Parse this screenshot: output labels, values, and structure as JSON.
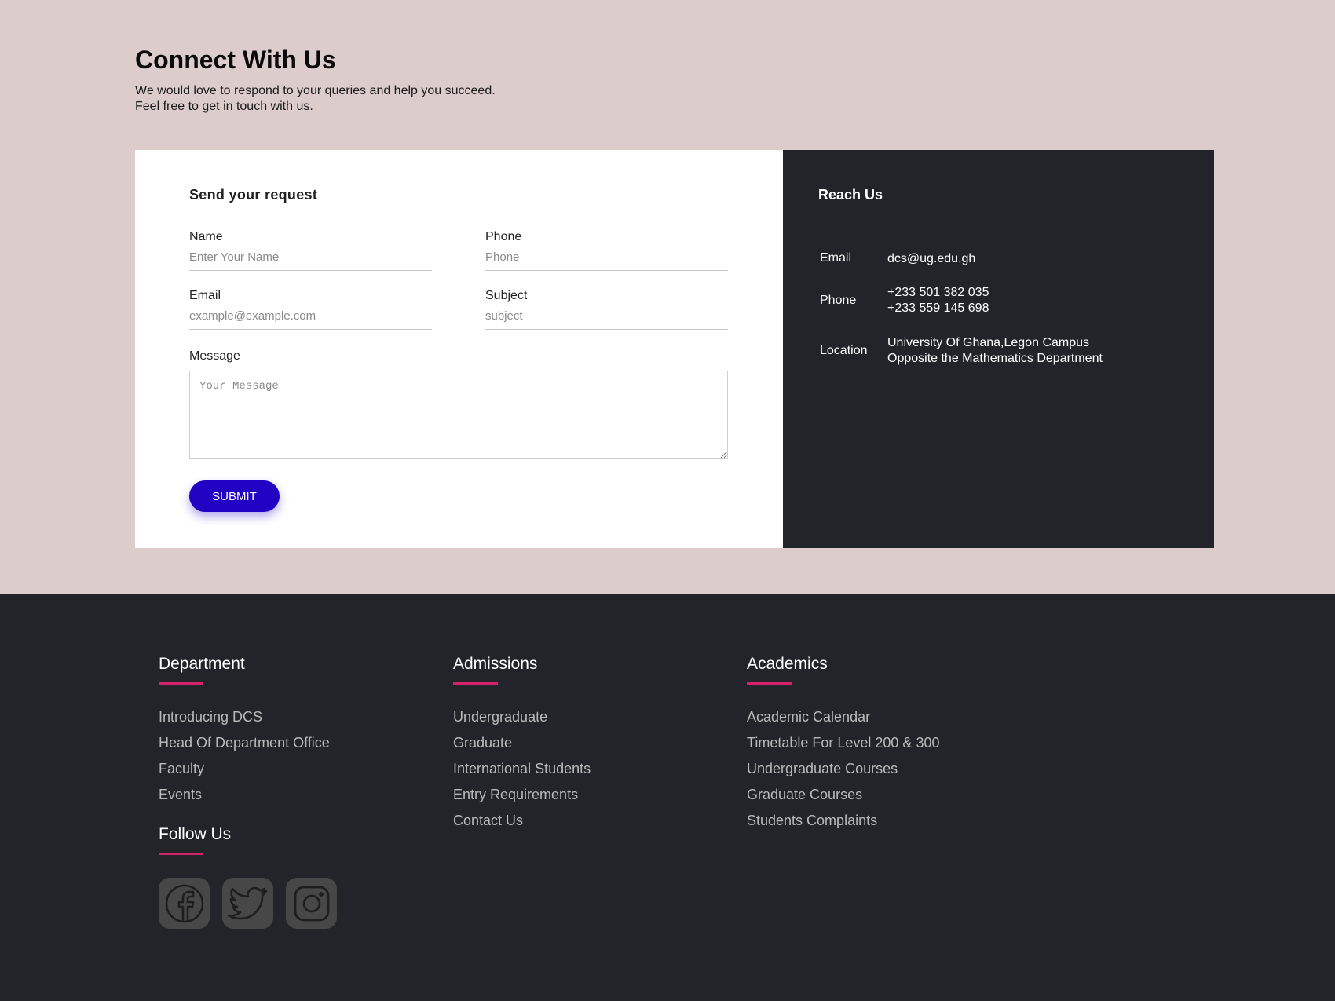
{
  "header": {
    "title": "Connect With Us",
    "subtitle_line1": "We would love to respond to your queries and help you succeed.",
    "subtitle_line2": "Feel free to get in touch with us."
  },
  "form": {
    "heading": "Send your request",
    "name": {
      "label": "Name",
      "placeholder": "Enter Your Name",
      "value": ""
    },
    "phone": {
      "label": "Phone",
      "placeholder": "Phone",
      "value": ""
    },
    "email": {
      "label": "Email",
      "placeholder": "example@example.com",
      "value": ""
    },
    "subject": {
      "label": "Subject",
      "placeholder": "subject",
      "value": ""
    },
    "message": {
      "label": "Message",
      "placeholder": "Your Message",
      "value": ""
    },
    "submit_label": "SUBMIT"
  },
  "reach": {
    "heading": "Reach Us",
    "email_label": "Email",
    "email_value": "dcs@ug.edu.gh",
    "phone_label": "Phone",
    "phone_line1": "+233 501 382 035",
    "phone_line2": "+233 559 145 698",
    "location_label": "Location",
    "location_line1": "University Of Ghana,Legon Campus",
    "location_line2": "Opposite the Mathematics Department"
  },
  "footer": {
    "department": {
      "title": "Department",
      "items": [
        "Introducing DCS",
        "Head Of Department Office",
        "Faculty",
        "Events"
      ]
    },
    "admissions": {
      "title": "Admissions",
      "items": [
        "Undergraduate",
        "Graduate",
        "International Students",
        "Entry Requirements",
        "Contact Us"
      ]
    },
    "academics": {
      "title": "Academics",
      "items": [
        "Academic Calendar",
        "Timetable For Level 200 & 300",
        "Undergraduate Courses",
        "Graduate Courses",
        "Students Complaints"
      ]
    },
    "follow": {
      "title": "Follow Us",
      "icons": [
        "facebook-icon",
        "twitter-icon",
        "instagram-icon"
      ]
    }
  },
  "colors": {
    "page_bg": "#dccccc",
    "dark_bg": "#232429",
    "submit_bg": "#2203c4",
    "accent_underline": "#d5206a",
    "social_bg": "#474747"
  }
}
